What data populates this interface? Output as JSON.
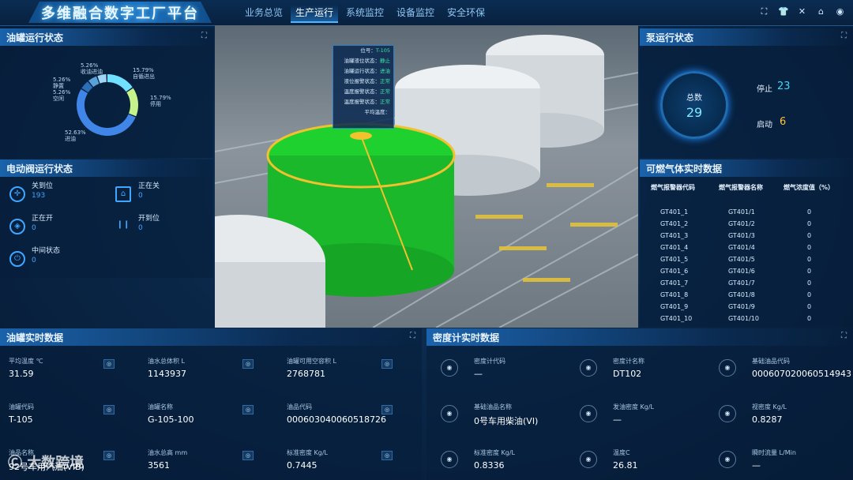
{
  "header": {
    "title": "多维融合数字工厂平台",
    "tabs": [
      "业务总览",
      "生产运行",
      "系统监控",
      "设备监控",
      "安全环保"
    ],
    "active_tab": 1
  },
  "tank_status": {
    "title": "油罐运行状态",
    "segments": [
      {
        "label": "5.26%",
        "name": "收油进油",
        "value": 5.26,
        "color": "#9fd6f6"
      },
      {
        "label": "5.26%",
        "name": "静置",
        "value": 5.26,
        "color": "#5aa0d9"
      },
      {
        "label": "5.26%",
        "name": "空闲",
        "value": 5.26,
        "color": "#2b6fb8"
      },
      {
        "label": "15.79%",
        "name": "自循进出",
        "value": 15.79,
        "color": "#6fe0ff"
      },
      {
        "label": "15.79%",
        "name": "停用",
        "value": 15.79,
        "color": "#c6f28a"
      },
      {
        "label": "52.63%",
        "name": "进油",
        "value": 52.63,
        "color": "#3f86e8"
      }
    ]
  },
  "valve_status": {
    "title": "电动阀运行状态",
    "items": [
      {
        "label": "关到位",
        "value": "193"
      },
      {
        "label": "正在关",
        "value": "0"
      },
      {
        "label": "正在开",
        "value": "0"
      },
      {
        "label": "开到位",
        "value": "0"
      },
      {
        "label": "中间状态",
        "value": "0"
      }
    ]
  },
  "popup": {
    "rows": [
      {
        "k": "位号：",
        "v": "T-105"
      },
      {
        "k": "油罐液位状态：",
        "v": "静止"
      },
      {
        "k": "油罐运行状态：",
        "v": "进油"
      },
      {
        "k": "液位报警状态：",
        "v": "正常"
      },
      {
        "k": "温度报警状态：",
        "v": "正常"
      },
      {
        "k": "温度报警状态：",
        "v": "正常"
      },
      {
        "k": "平均温度：",
        "v": ""
      }
    ]
  },
  "pump_status": {
    "title": "泵运行状态",
    "total_label": "总数",
    "total_value": "29",
    "stop_label": "停止",
    "stop_value": "23",
    "run_label": "启动",
    "run_value": "6"
  },
  "gas": {
    "title": "可燃气体实时数据",
    "headers": [
      "燃气报警器代码",
      "燃气报警器名称",
      "燃气浓度值（%）"
    ],
    "rows": [
      [
        "GT401_1",
        "GT401/1",
        "0"
      ],
      [
        "GT401_2",
        "GT401/2",
        "0"
      ],
      [
        "GT401_3",
        "GT401/3",
        "0"
      ],
      [
        "GT401_4",
        "GT401/4",
        "0"
      ],
      [
        "GT401_5",
        "GT401/5",
        "0"
      ],
      [
        "GT401_6",
        "GT401/6",
        "0"
      ],
      [
        "GT401_7",
        "GT401/7",
        "0"
      ],
      [
        "GT401_8",
        "GT401/8",
        "0"
      ],
      [
        "GT401_9",
        "GT401/9",
        "0"
      ],
      [
        "GT401_10",
        "GT401/10",
        "0"
      ]
    ]
  },
  "tank_data": {
    "title": "油罐实时数据",
    "cells": [
      {
        "k": "平均温度 ℃",
        "v": "31.59"
      },
      {
        "k": "油水总体积 L",
        "v": "1143937"
      },
      {
        "k": "油罐可用空容积 L",
        "v": "2768781"
      },
      {
        "k": "油罐代码",
        "v": "T-105"
      },
      {
        "k": "油罐名称",
        "v": "G-105-100"
      },
      {
        "k": "油品代码",
        "v": "000603040060518726"
      },
      {
        "k": "油品名称",
        "v": "92号车用汽油(VIB)"
      },
      {
        "k": "油水总高 mm",
        "v": "3561"
      },
      {
        "k": "标准密度 Kg/L",
        "v": "0.7445"
      }
    ]
  },
  "density": {
    "title": "密度计实时数据",
    "cells": [
      {
        "k": "密度计代码",
        "v": "—"
      },
      {
        "k": "密度计名称",
        "v": "DT102"
      },
      {
        "k": "基础油品代码",
        "v": "000607020060514943"
      },
      {
        "k": "基础油品名称",
        "v": "0号车用柴油(VI)"
      },
      {
        "k": "发油密度 Kg/L",
        "v": "—"
      },
      {
        "k": "视密度 Kg/L",
        "v": "0.8287"
      },
      {
        "k": "标准密度 Kg/L",
        "v": "0.8336"
      },
      {
        "k": "温度C",
        "v": "26.81"
      },
      {
        "k": "瞬时流量 L/Min",
        "v": "—"
      }
    ]
  },
  "watermark": "大数跨境"
}
